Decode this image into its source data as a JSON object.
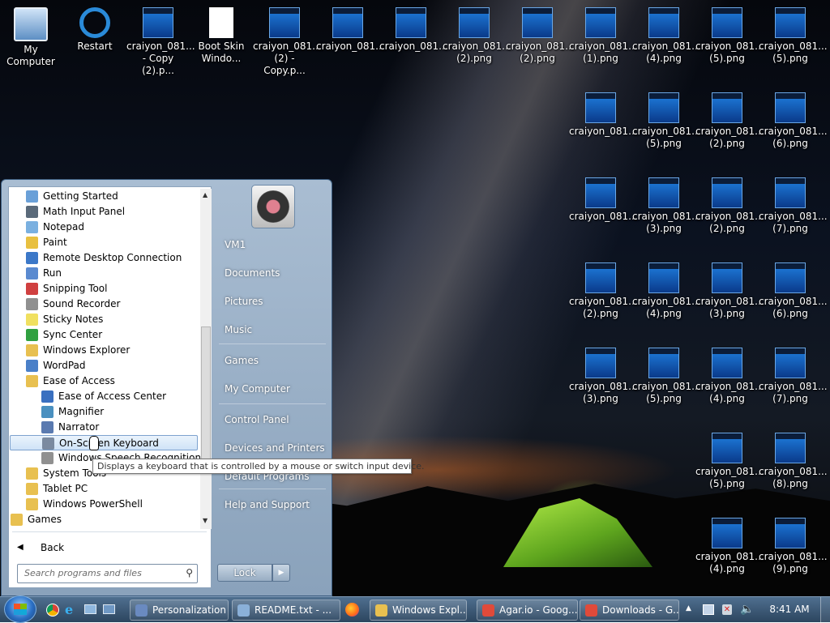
{
  "desktop": {
    "icons": [
      {
        "line1": "My Computer",
        "line2": "",
        "kind": "computer"
      },
      {
        "line1": "Restart",
        "line2": "",
        "kind": "restart"
      },
      {
        "line1": "craiyon_081...",
        "line2": "- Copy (2).p...",
        "kind": "thumb"
      },
      {
        "line1": "Boot Skin",
        "line2": "Windo...",
        "kind": "doc"
      },
      {
        "line1": "craiyon_081...",
        "line2": "(2) - Copy.p...",
        "kind": "thumb"
      },
      {
        "line1": "craiyon_081...",
        "line2": "",
        "kind": "thumb"
      },
      {
        "line1": "craiyon_081...",
        "line2": "",
        "kind": "thumb"
      },
      {
        "line1": "craiyon_081...",
        "line2": "(2).png",
        "kind": "thumb"
      },
      {
        "line1": "craiyon_081...",
        "line2": "(2).png",
        "kind": "thumb"
      },
      {
        "line1": "craiyon_081...",
        "line2": "(1).png",
        "kind": "thumb"
      },
      {
        "line1": "craiyon_081...",
        "line2": "(4).png",
        "kind": "thumb"
      },
      {
        "line1": "craiyon_081...",
        "line2": "(5).png",
        "kind": "thumb"
      },
      {
        "line1": "craiyon_081...",
        "line2": "(5).png",
        "kind": "thumb"
      },
      {
        "line1": "craiyon_081...",
        "line2": "",
        "kind": "thumb"
      },
      {
        "line1": "craiyon_081...",
        "line2": "(5).png",
        "kind": "thumb"
      },
      {
        "line1": "craiyon_081...",
        "line2": "(2).png",
        "kind": "thumb"
      },
      {
        "line1": "craiyon_081...",
        "line2": "(6).png",
        "kind": "thumb"
      },
      {
        "line1": "craiyon_081...",
        "line2": "",
        "kind": "thumb"
      },
      {
        "line1": "craiyon_081...",
        "line2": "(3).png",
        "kind": "thumb"
      },
      {
        "line1": "craiyon_081...",
        "line2": "(2).png",
        "kind": "thumb"
      },
      {
        "line1": "craiyon_081...",
        "line2": "(7).png",
        "kind": "thumb"
      },
      {
        "line1": "craiyon_081...",
        "line2": "(2).png",
        "kind": "thumb"
      },
      {
        "line1": "craiyon_081...",
        "line2": "(4).png",
        "kind": "thumb"
      },
      {
        "line1": "craiyon_081...",
        "line2": "(3).png",
        "kind": "thumb"
      },
      {
        "line1": "craiyon_081...",
        "line2": "(6).png",
        "kind": "thumb"
      },
      {
        "line1": "craiyon_081...",
        "line2": "(3).png",
        "kind": "thumb"
      },
      {
        "line1": "craiyon_081...",
        "line2": "(5).png",
        "kind": "thumb"
      },
      {
        "line1": "craiyon_081...",
        "line2": "(4).png",
        "kind": "thumb"
      },
      {
        "line1": "craiyon_081...",
        "line2": "(7).png",
        "kind": "thumb"
      },
      {
        "line1": "craiyon_081...",
        "line2": "(5).png",
        "kind": "thumb"
      },
      {
        "line1": "craiyon_081...",
        "line2": "(8).png",
        "kind": "thumb"
      },
      {
        "line1": "craiyon_081...",
        "line2": "(4).png",
        "kind": "thumb"
      },
      {
        "line1": "craiyon_081...",
        "line2": "(9).png",
        "kind": "thumb"
      }
    ]
  },
  "start_menu": {
    "programs": [
      {
        "label": "Getting Started",
        "icon": "getting-started-icon",
        "color": "#6aa0d8"
      },
      {
        "label": "Math Input Panel",
        "icon": "math-input-icon",
        "color": "#5a6a7a"
      },
      {
        "label": "Notepad",
        "icon": "notepad-icon",
        "color": "#7ab0e0"
      },
      {
        "label": "Paint",
        "icon": "paint-icon",
        "color": "#e8c040"
      },
      {
        "label": "Remote Desktop Connection",
        "icon": "remote-desktop-icon",
        "color": "#3c78c8"
      },
      {
        "label": "Run",
        "icon": "run-icon",
        "color": "#5a8ad0"
      },
      {
        "label": "Snipping Tool",
        "icon": "snipping-tool-icon",
        "color": "#d04040"
      },
      {
        "label": "Sound Recorder",
        "icon": "sound-recorder-icon",
        "color": "#909090"
      },
      {
        "label": "Sticky Notes",
        "icon": "sticky-notes-icon",
        "color": "#f0e060"
      },
      {
        "label": "Sync Center",
        "icon": "sync-center-icon",
        "color": "#30a040"
      },
      {
        "label": "Windows Explorer",
        "icon": "windows-explorer-icon",
        "color": "#e8c050"
      },
      {
        "label": "WordPad",
        "icon": "wordpad-icon",
        "color": "#4a80c8"
      },
      {
        "label": "Ease of Access",
        "icon": "folder-icon",
        "color": "#e8c050"
      },
      {
        "label": "Ease of Access Center",
        "icon": "ease-of-access-icon",
        "color": "#3a70c0",
        "indent": true
      },
      {
        "label": "Magnifier",
        "icon": "magnifier-icon",
        "color": "#4a90c0",
        "indent": true
      },
      {
        "label": "Narrator",
        "icon": "narrator-icon",
        "color": "#5a7ab0",
        "indent": true
      },
      {
        "label": "On-Screen Keyboard",
        "icon": "keyboard-icon",
        "color": "#7a8aa0",
        "indent": true,
        "selected": true
      },
      {
        "label": "Windows Speech Recognition",
        "icon": "microphone-icon",
        "color": "#909090",
        "indent": true
      },
      {
        "label": "System Tools",
        "icon": "folder-icon",
        "color": "#e8c050"
      },
      {
        "label": "Tablet PC",
        "icon": "folder-icon",
        "color": "#e8c050"
      },
      {
        "label": "Windows PowerShell",
        "icon": "folder-icon",
        "color": "#e8c050"
      },
      {
        "label": "Games",
        "icon": "folder-icon",
        "color": "#e8c050",
        "outdent": true
      }
    ],
    "back_label": "Back",
    "search_placeholder": "Search programs and files",
    "tooltip": "Displays a keyboard that is controlled by a mouse or switch input device.",
    "right_items": [
      {
        "label": "VM1"
      },
      {
        "label": "Documents"
      },
      {
        "label": "Pictures"
      },
      {
        "label": "Music"
      },
      {
        "label": "Games"
      },
      {
        "label": "My Computer"
      },
      {
        "label": "Control Panel"
      },
      {
        "label": "Devices and Printers"
      },
      {
        "label": "Default Programs"
      },
      {
        "label": "Help and Support"
      }
    ],
    "lock_label": "Lock"
  },
  "taskbar": {
    "buttons": [
      {
        "label": "Personalization",
        "color": "#6a8ac0"
      },
      {
        "label": "README.txt - ...",
        "color": "#8ab0d8"
      },
      {
        "label": "Windows Expl...",
        "color": "#e8c050"
      },
      {
        "label": "Agar.io - Goog...",
        "color": "#e04a3a"
      },
      {
        "label": "Downloads - G...",
        "color": "#e04a3a"
      }
    ],
    "clock": "8:41 AM"
  }
}
